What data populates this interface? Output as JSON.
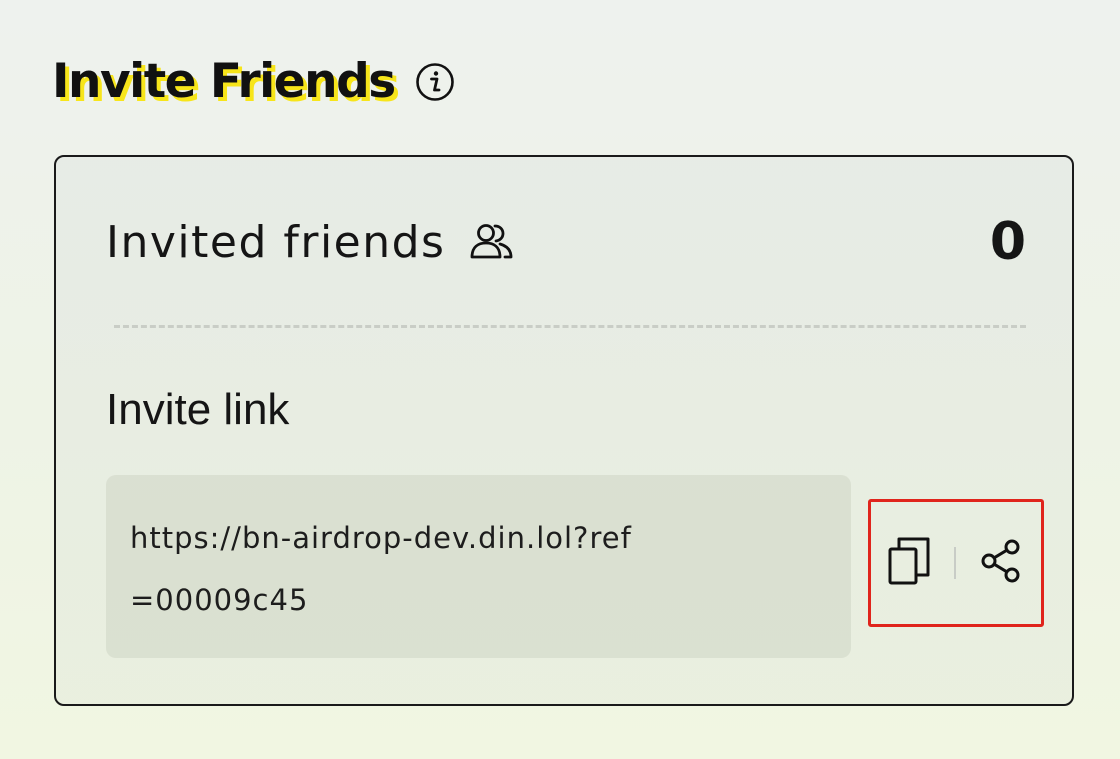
{
  "header": {
    "title": "Invite Friends",
    "info_icon": "info-icon"
  },
  "card": {
    "friends_label": "Invited friends",
    "friends_icon": "users-icon",
    "friends_count": "0",
    "invite_label": "Invite link",
    "invite_link": "https://bn-airdrop-dev.din.lol?ref=00009c45",
    "actions": {
      "copy_icon": "copy-icon",
      "share_icon": "share-icon",
      "highlight_color": "#e0241c"
    }
  },
  "colors": {
    "title_highlight": "#f7e51a",
    "text": "#111111"
  }
}
